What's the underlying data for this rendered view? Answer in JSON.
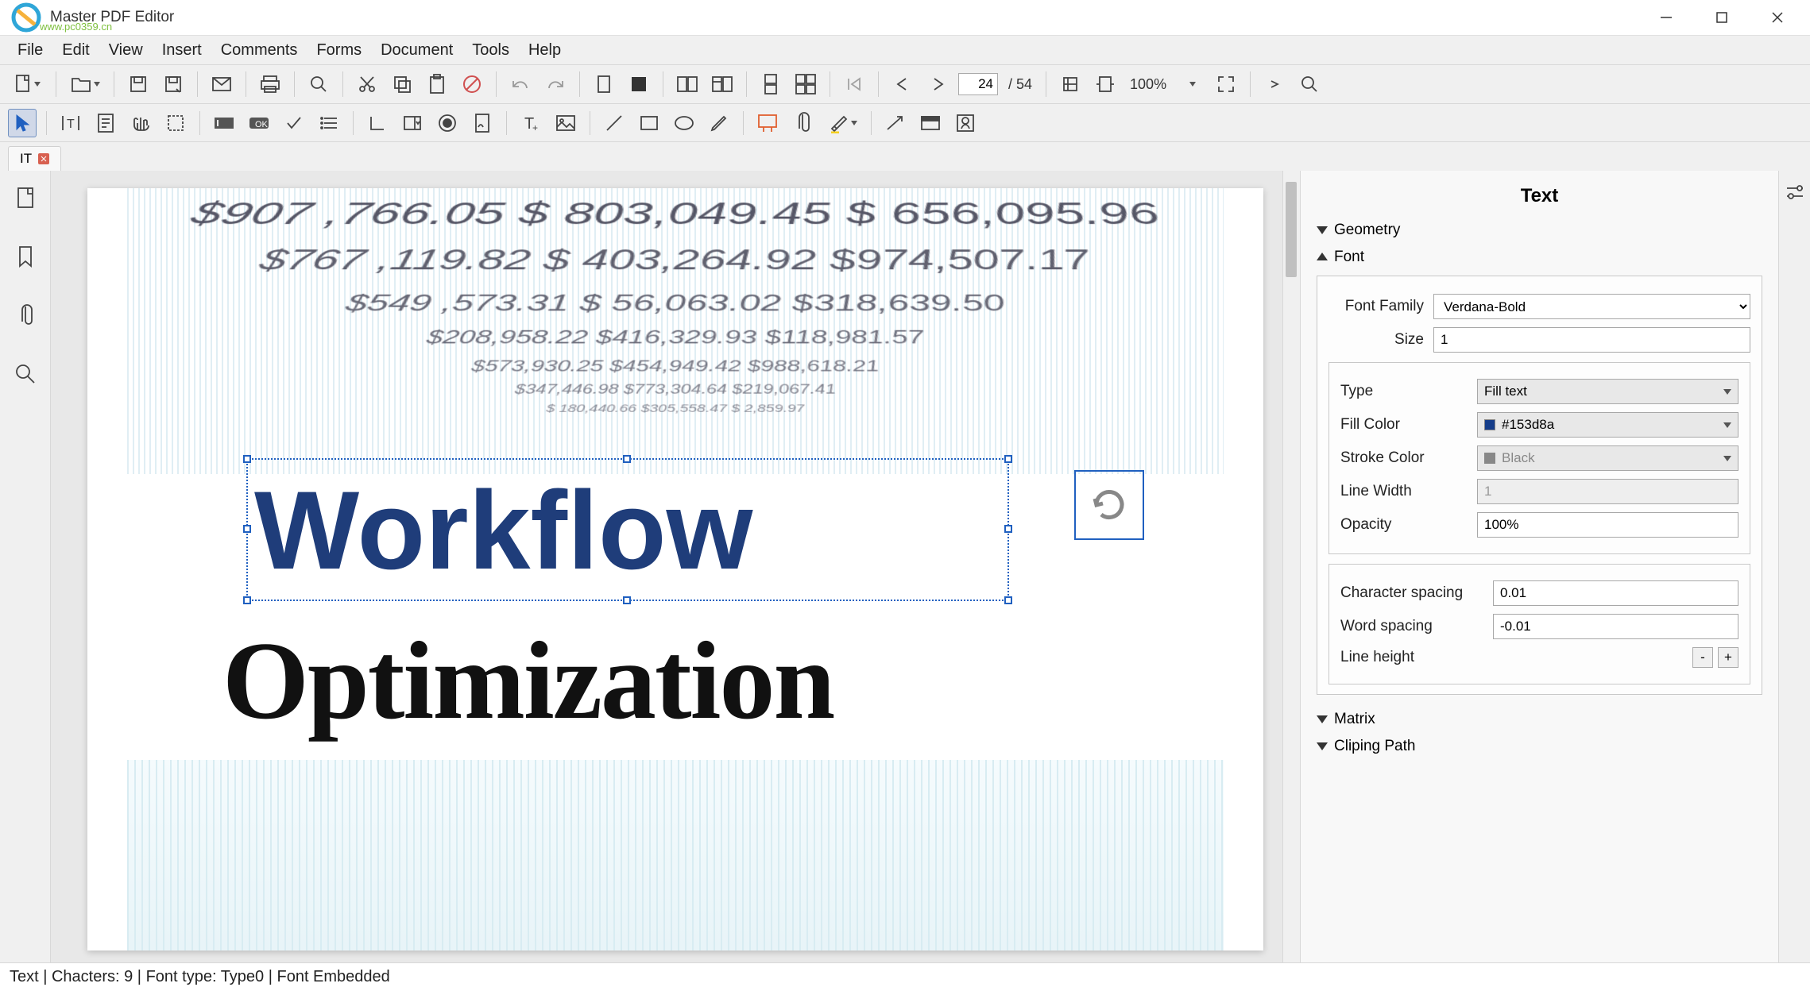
{
  "app": {
    "title": "Master PDF Editor",
    "watermark_url": "www.pc0359.cn"
  },
  "menu": [
    "File",
    "Edit",
    "View",
    "Insert",
    "Comments",
    "Forms",
    "Document",
    "Tools",
    "Help"
  ],
  "tab": {
    "label": "IT"
  },
  "toolbar": {
    "page_current": "24",
    "page_total": "/ 54",
    "zoom": "100%"
  },
  "panel": {
    "title": "Text",
    "sections": {
      "geometry": "Geometry",
      "font": "Font",
      "matrix": "Matrix",
      "clip": "Cliping Path"
    },
    "font": {
      "family_label": "Font Family",
      "family_value": "Verdana-Bold",
      "size_label": "Size",
      "size_value": "1",
      "type_label": "Type",
      "type_value": "Fill text",
      "fill_label": "Fill Color",
      "fill_value": "#153d8a",
      "stroke_label": "Stroke Color",
      "stroke_value": "Black",
      "linewidth_label": "Line Width",
      "linewidth_value": "1",
      "opacity_label": "Opacity",
      "opacity_value": "100%",
      "charsp_label": "Character spacing",
      "charsp_value": "0.01",
      "wordsp_label": "Word spacing",
      "wordsp_value": "-0.01",
      "lineh_label": "Line height"
    }
  },
  "doc": {
    "numbers": [
      "$907 ,766.05   $ 803,049.45   $ 656,095.96",
      "$767 ,119.82   $ 403,264.92   $974,507.17",
      "$549 ,573.31   $  56,063.02   $318,639.50",
      "$208,958.22   $416,329.93   $118,981.57",
      "$573,930.25   $454,949.42   $988,618.21",
      "$347,446.98   $773,304.64   $219,067.41",
      "$ 180,440.66   $305,558.47   $ 2,859.97"
    ],
    "heading1": "Workflow",
    "heading2": "Optimization"
  },
  "status": "Text | Chacters: 9 | Font type: Type0 | Font Embedded"
}
